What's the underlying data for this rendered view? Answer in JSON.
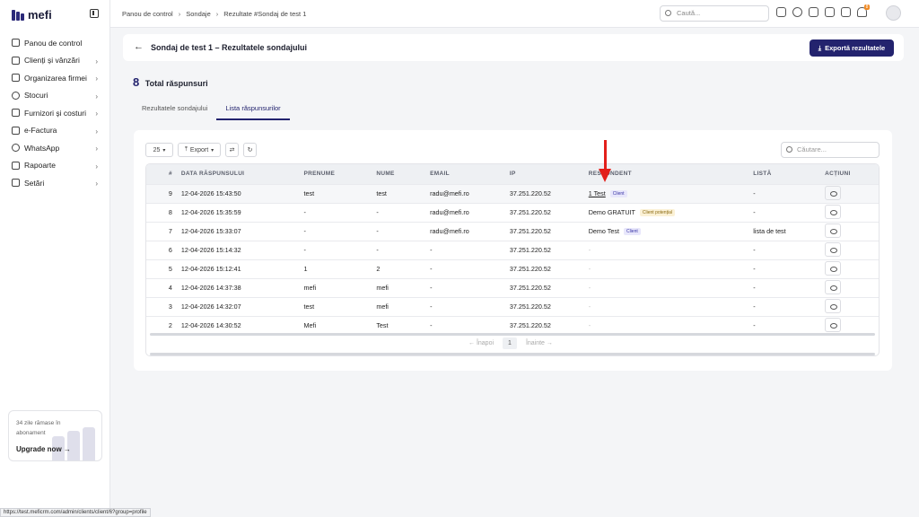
{
  "app": {
    "name": "mefi"
  },
  "sidebar": {
    "items": [
      {
        "label": "Panou de control",
        "has_chevron": false
      },
      {
        "label": "Clienți și vânzări",
        "has_chevron": true
      },
      {
        "label": "Organizarea firmei",
        "has_chevron": true
      },
      {
        "label": "Stocuri",
        "has_chevron": true
      },
      {
        "label": "Furnizori și costuri",
        "has_chevron": true
      },
      {
        "label": "e-Factura",
        "has_chevron": true
      },
      {
        "label": "WhatsApp",
        "has_chevron": true
      },
      {
        "label": "Rapoarte",
        "has_chevron": true
      },
      {
        "label": "Setări",
        "has_chevron": true
      }
    ],
    "upgrade": {
      "text": "34 zile rămase în abonament",
      "link": "Upgrade now"
    }
  },
  "topbar": {
    "breadcrumbs": [
      "Panou de control",
      "Sondaje",
      "Rezultate #Sondaj de test 1"
    ],
    "search_placeholder": "Caută...",
    "notification_count": "8"
  },
  "header": {
    "title": "Sondaj de test 1 – Rezultatele sondajului",
    "export_label": "Exportă rezultatele"
  },
  "summary": {
    "total": "8",
    "label": "Total răspunsuri"
  },
  "tabs": [
    {
      "label": "Rezultatele sondajului",
      "active": false
    },
    {
      "label": "Lista răspunsurilor",
      "active": true
    }
  ],
  "toolbar": {
    "page_size": "25",
    "export_label": "Export",
    "search_placeholder": "Căutare..."
  },
  "table": {
    "columns": [
      "#",
      "DATA RĂSPUNSULUI",
      "PRENUME",
      "NUME",
      "EMAIL",
      "IP",
      "RESPONDENT",
      "LISTĂ",
      "ACȚIUNI"
    ],
    "rows": [
      {
        "n": "9",
        "date": "12-04-2026 15:43:50",
        "first": "test",
        "last": "test",
        "email": "radu@mefi.ro",
        "ip": "37.251.220.52",
        "respondent": "1 Test",
        "tag": "Client",
        "tag_type": "client",
        "list": "-"
      },
      {
        "n": "8",
        "date": "12-04-2026 15:35:59",
        "first": "-",
        "last": "-",
        "email": "radu@mefi.ro",
        "ip": "37.251.220.52",
        "respondent": "Demo GRATUIT",
        "tag": "Client potențial",
        "tag_type": "pot",
        "list": "-"
      },
      {
        "n": "7",
        "date": "12-04-2026 15:33:07",
        "first": "-",
        "last": "-",
        "email": "radu@mefi.ro",
        "ip": "37.251.220.52",
        "respondent": "Demo Test",
        "tag": "Client",
        "tag_type": "client",
        "list": "lista de test"
      },
      {
        "n": "6",
        "date": "12-04-2026 15:14:32",
        "first": "-",
        "last": "-",
        "email": "-",
        "ip": "37.251.220.52",
        "respondent": "-",
        "tag": "",
        "tag_type": "",
        "list": "-"
      },
      {
        "n": "5",
        "date": "12-04-2026 15:12:41",
        "first": "1",
        "last": "2",
        "email": "-",
        "ip": "37.251.220.52",
        "respondent": "-",
        "tag": "",
        "tag_type": "",
        "list": "-"
      },
      {
        "n": "4",
        "date": "12-04-2026 14:37:38",
        "first": "mefi",
        "last": "mefi",
        "email": "-",
        "ip": "37.251.220.52",
        "respondent": "-",
        "tag": "",
        "tag_type": "",
        "list": "-"
      },
      {
        "n": "3",
        "date": "12-04-2026 14:32:07",
        "first": "test",
        "last": "mefi",
        "email": "-",
        "ip": "37.251.220.52",
        "respondent": "-",
        "tag": "",
        "tag_type": "",
        "list": "-"
      },
      {
        "n": "2",
        "date": "12-04-2026 14:30:52",
        "first": "Mefi",
        "last": "Test",
        "email": "-",
        "ip": "37.251.220.52",
        "respondent": "-",
        "tag": "",
        "tag_type": "",
        "list": "-"
      }
    ]
  },
  "pagination": {
    "prev": "← Înapoi",
    "page": "1",
    "next": "Înainte →"
  },
  "status_url": "https://test.meficrm.com/admin/clients/client/6?group=profile"
}
